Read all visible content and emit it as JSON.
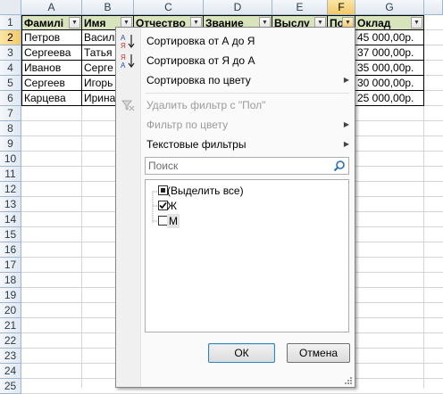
{
  "columns": [
    "A",
    "B",
    "C",
    "D",
    "E",
    "F",
    "G"
  ],
  "selected_column": "F",
  "rows": [
    "1",
    "2",
    "3",
    "4",
    "5",
    "6",
    "7",
    "8",
    "9",
    "10",
    "11",
    "12",
    "13",
    "14",
    "15",
    "16",
    "17",
    "18",
    "19",
    "20",
    "21",
    "22",
    "23",
    "24",
    "25"
  ],
  "selected_row": "2",
  "headers": [
    "Фамилия",
    "Имя",
    "Отчество",
    "Звание",
    "Выслуга",
    "Пол",
    "Оклад"
  ],
  "header_display": [
    "Фамилі",
    "Имя",
    "Отчество",
    "Звание",
    "Выслу",
    "По",
    "Оклад"
  ],
  "table": [
    {
      "a": "Петров",
      "b": "Васил",
      "g": "45 000,00р."
    },
    {
      "a": "Сергеева",
      "b": "Татья",
      "g": "37 000,00р."
    },
    {
      "a": "Иванов",
      "b": "Серге",
      "g": "35 000,00р."
    },
    {
      "a": "Сергеев",
      "b": "Игорь",
      "g": "30 000,00р."
    },
    {
      "a": "Карцева",
      "b": "Ирина",
      "g": "25 000,00р."
    }
  ],
  "menu": {
    "sort_asc": "Сортировка от А до Я",
    "sort_desc": "Сортировка от Я до А",
    "sort_color": "Сортировка по цвету",
    "clear_filter": "Удалить фильтр с \"Пол\"",
    "filter_color": "Фильтр по цвету",
    "text_filters": "Текстовые фильтры",
    "search_placeholder": "Поиск",
    "select_all": "(Выделить все)",
    "values": [
      {
        "label": "Ж",
        "checked": true
      },
      {
        "label": "М",
        "checked": false
      }
    ],
    "ok": "ОК",
    "cancel": "Отмена"
  }
}
